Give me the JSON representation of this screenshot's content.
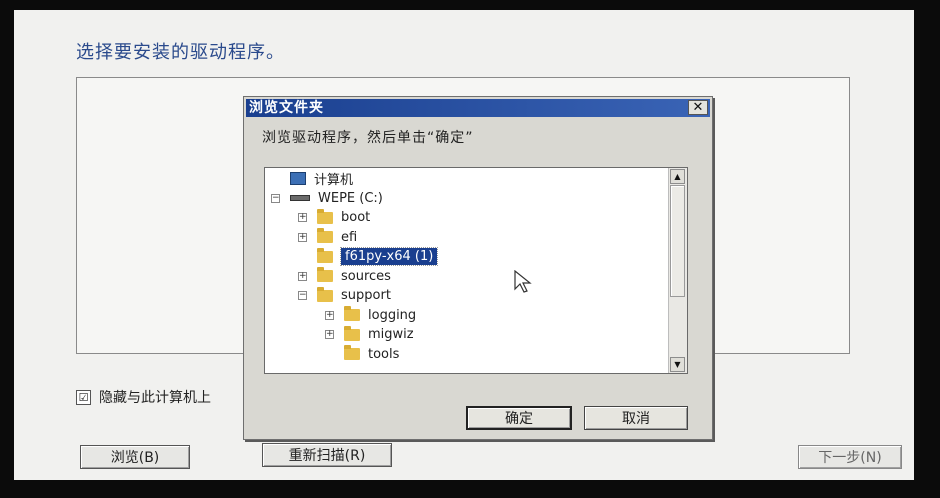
{
  "installer": {
    "title": "选择要安装的驱动程序。",
    "hide_checkbox_label": "隐藏与此计算机上",
    "hide_checked_glyph": "☑",
    "buttons": {
      "browse": "浏览(B)",
      "rescan": "重新扫描(R)",
      "next": "下一步(N)"
    }
  },
  "dialog": {
    "title": "浏览文件夹",
    "close_glyph": "✕",
    "instruction": "浏览驱动程序，然后单击“确定”",
    "tree": [
      {
        "label": "计算机",
        "icon": "computer-icon",
        "expander": "",
        "level": 0
      },
      {
        "label": "WEPE (C:)",
        "icon": "drive-icon",
        "expander": "−",
        "level": 0
      },
      {
        "label": "boot",
        "icon": "folder-icon",
        "expander": "+",
        "level": 1
      },
      {
        "label": "efi",
        "icon": "folder-icon",
        "expander": "+",
        "level": 1
      },
      {
        "label": "f61py-x64 (1)",
        "icon": "folder-icon",
        "expander": "",
        "level": 1,
        "selected": true
      },
      {
        "label": "sources",
        "icon": "folder-icon",
        "expander": "+",
        "level": 1
      },
      {
        "label": "support",
        "icon": "folder-icon",
        "expander": "−",
        "level": 1
      },
      {
        "label": "logging",
        "icon": "folder-icon",
        "expander": "+",
        "level": 2
      },
      {
        "label": "migwiz",
        "icon": "folder-icon",
        "expander": "+",
        "level": 2
      },
      {
        "label": "tools",
        "icon": "folder-icon",
        "expander": "",
        "level": 2
      }
    ],
    "ok_label": "确定",
    "cancel_label": "取消",
    "scroll_up_glyph": "▲",
    "scroll_down_glyph": "▼"
  }
}
